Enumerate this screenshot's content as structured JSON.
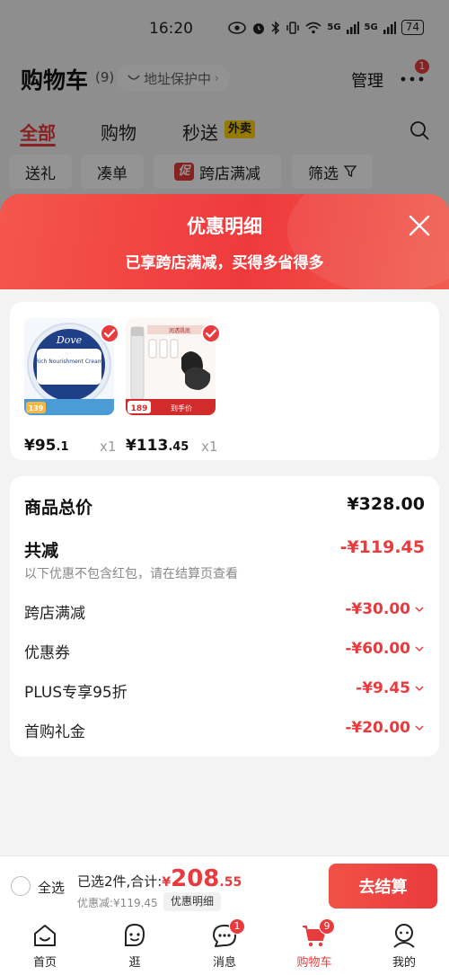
{
  "status_bar": {
    "time": "16:20",
    "network_label_1": "5G",
    "network_label_2": "5G",
    "battery": "74"
  },
  "header": {
    "title": "购物车",
    "count": "(9)",
    "address_label": "地址保护中",
    "manage_label": "管理",
    "more_badge": "1"
  },
  "tabs": [
    {
      "label": "全部"
    },
    {
      "label": "购物"
    },
    {
      "label": "秒送"
    }
  ],
  "tab_tag": "外卖",
  "filters": {
    "gift": "送礼",
    "combine": "凑单",
    "promo_tag": "促",
    "cross_store": "跨店满减",
    "filter": "筛选"
  },
  "sheet": {
    "title": "优惠明细",
    "subtitle": "已享跨店满减，买得多省得多"
  },
  "products": [
    {
      "price_int": "¥95",
      "price_dec": ".1",
      "qty": "x1",
      "img_alt_brand": "Dove",
      "img_caption": "Rich Nourishment Cream",
      "img_price": "139"
    },
    {
      "price_int": "¥113",
      "price_dec": ".45",
      "qty": "x1",
      "img_caption": "润透肌底",
      "img_price": "189",
      "img_promo": "到手价"
    }
  ],
  "details": {
    "total_label": "商品总价",
    "total_value": "¥328.00",
    "discount_label": "共减",
    "discount_value": "-¥119.45",
    "discount_note": "以下优惠不包含红包，请在结算页查看",
    "lines": [
      {
        "label": "跨店满减",
        "value": "-¥30.00"
      },
      {
        "label": "优惠券",
        "value": "-¥60.00"
      },
      {
        "label": "PLUS专享95折",
        "value": "-¥9.45"
      },
      {
        "label": "首购礼金",
        "value": "-¥20.00"
      }
    ]
  },
  "bottom_bar": {
    "select_all": "全选",
    "selected_summary": "已选2件,合计:",
    "currency": "¥",
    "total_main": "208",
    "total_dec": ".55",
    "saved_text": "优惠减:¥119.45",
    "detail_button": "优惠明细",
    "checkout_button": "去结算"
  },
  "tabbar": [
    {
      "label": "首页",
      "icon": "home-icon"
    },
    {
      "label": "逛",
      "icon": "browse-face-icon"
    },
    {
      "label": "消息",
      "icon": "message-icon",
      "badge": "1"
    },
    {
      "label": "购物车",
      "icon": "cart-icon",
      "badge": "9",
      "active": true
    },
    {
      "label": "我的",
      "icon": "profile-icon"
    }
  ],
  "colors": {
    "accent": "#e93b3d",
    "sheet_gradient": "#f4564c",
    "waimai_tag": "#ffd200"
  }
}
